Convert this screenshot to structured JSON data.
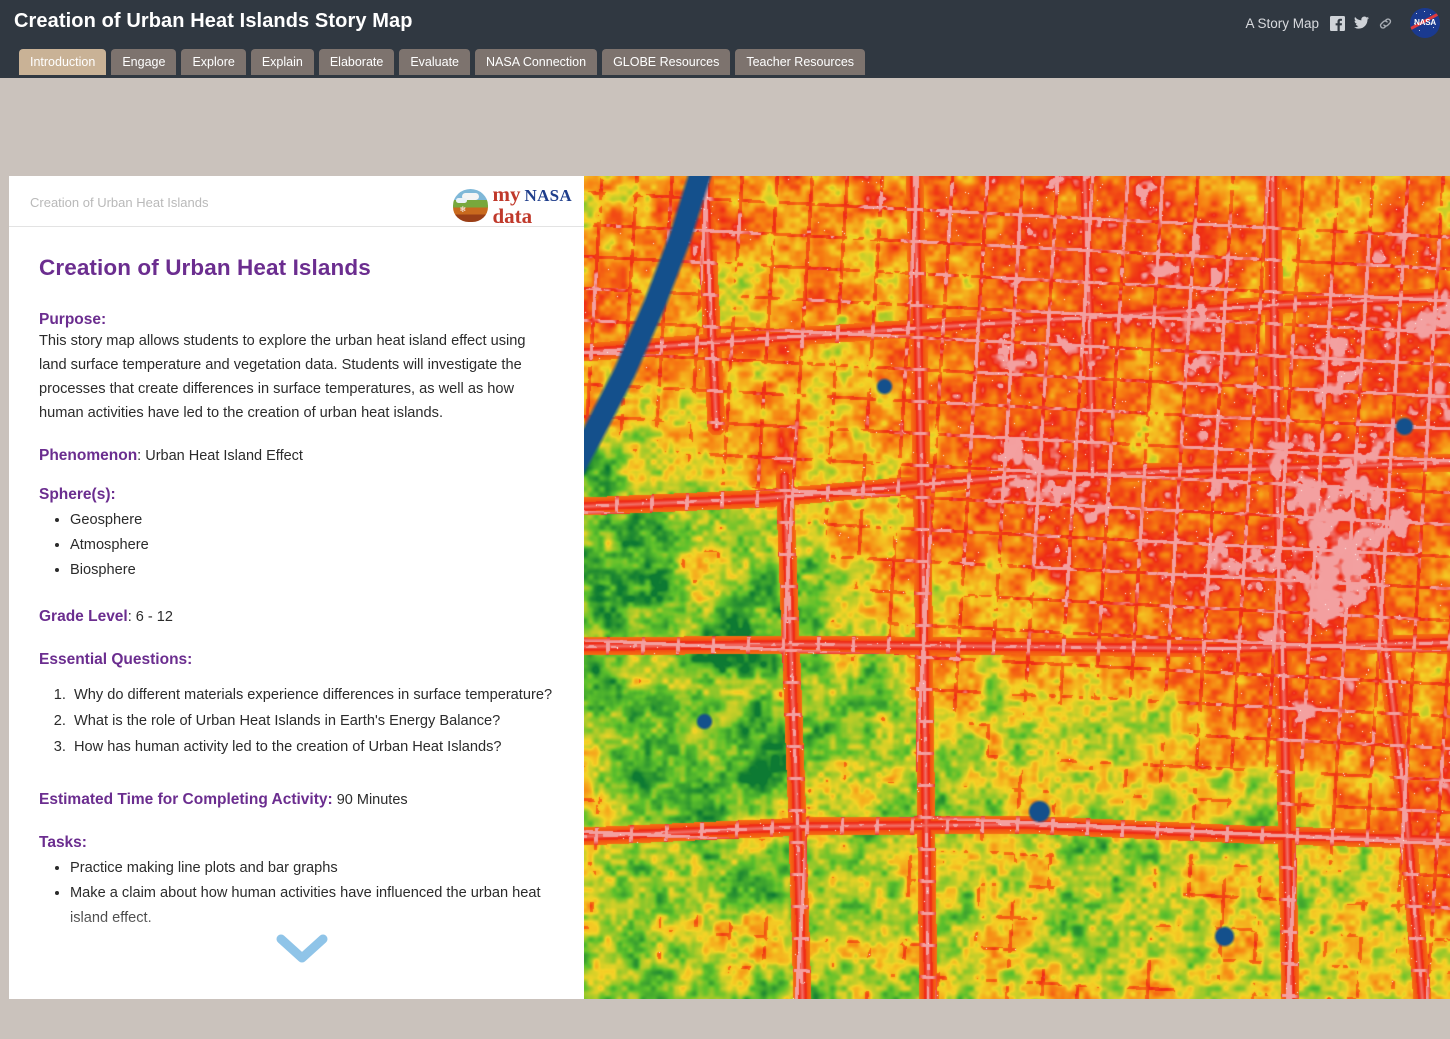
{
  "header": {
    "title": "Creation of Urban Heat Islands Story Map",
    "story_map_label": "A Story Map",
    "icons": [
      "facebook-icon",
      "twitter-icon",
      "link-icon",
      "nasa-logo"
    ],
    "nasa_wordmark": "NASA",
    "background_color": "#303841"
  },
  "tabs": {
    "active": "Introduction",
    "active_color": "#c9b296",
    "inactive_color": "#7d736e",
    "items": [
      {
        "label": "Introduction"
      },
      {
        "label": "Engage"
      },
      {
        "label": "Explore"
      },
      {
        "label": "Explain"
      },
      {
        "label": "Elaborate"
      },
      {
        "label": "Evaluate"
      },
      {
        "label": "NASA Connection"
      },
      {
        "label": "GLOBE Resources"
      },
      {
        "label": "Teacher Resources"
      }
    ]
  },
  "panel": {
    "breadcrumb": "Creation of Urban Heat Islands",
    "logo": {
      "my": "my",
      "nasa": "NASA",
      "data": "data"
    },
    "title": "Creation of Urban Heat Islands",
    "accent_color": "#6b2d8f",
    "purpose": {
      "heading": "Purpose:",
      "text": "This story map allows students to explore the urban heat island effect using land surface temperature and vegetation data. Students will investigate the processes that create differences in surface temperatures, as well as how human activities have led to the creation of urban heat islands."
    },
    "phenomenon": {
      "heading": "Phenomenon",
      "value": ": Urban Heat Island Effect"
    },
    "spheres": {
      "heading": "Sphere(s):",
      "items": [
        "Geosphere",
        "Atmosphere",
        "Biosphere"
      ]
    },
    "grade_level": {
      "heading": "Grade Level",
      "value": ": 6 - 12"
    },
    "essential_questions": {
      "heading": "Essential Questions:",
      "items": [
        "Why do different materials experience differences in surface temperature?",
        "What is the role of Urban Heat Islands in Earth's Energy Balance?",
        "How has human activity led to the creation of Urban Heat Islands?"
      ]
    },
    "estimated_time": {
      "heading": "Estimated Time for Completing Activity:",
      "value": " 90 Minutes"
    },
    "tasks": {
      "heading": "Tasks:",
      "items": [
        "Practice making line plots and bar graphs",
        "Make a claim about how human activities have influenced the urban heat island effect."
      ]
    },
    "scroll_indicator": "chevron-down-icon"
  },
  "map": {
    "description": "False-color land surface temperature / vegetation raster map of an urban area",
    "palette": {
      "water": "#14508c",
      "hot": "#ef2a16",
      "warm": "#f77c12",
      "mid": "#f4d427",
      "cool": "#5ec12c",
      "coldest": "#0d7a33",
      "built": "#f3a0a0"
    }
  },
  "page": {
    "background_color": "#cac2bc"
  }
}
